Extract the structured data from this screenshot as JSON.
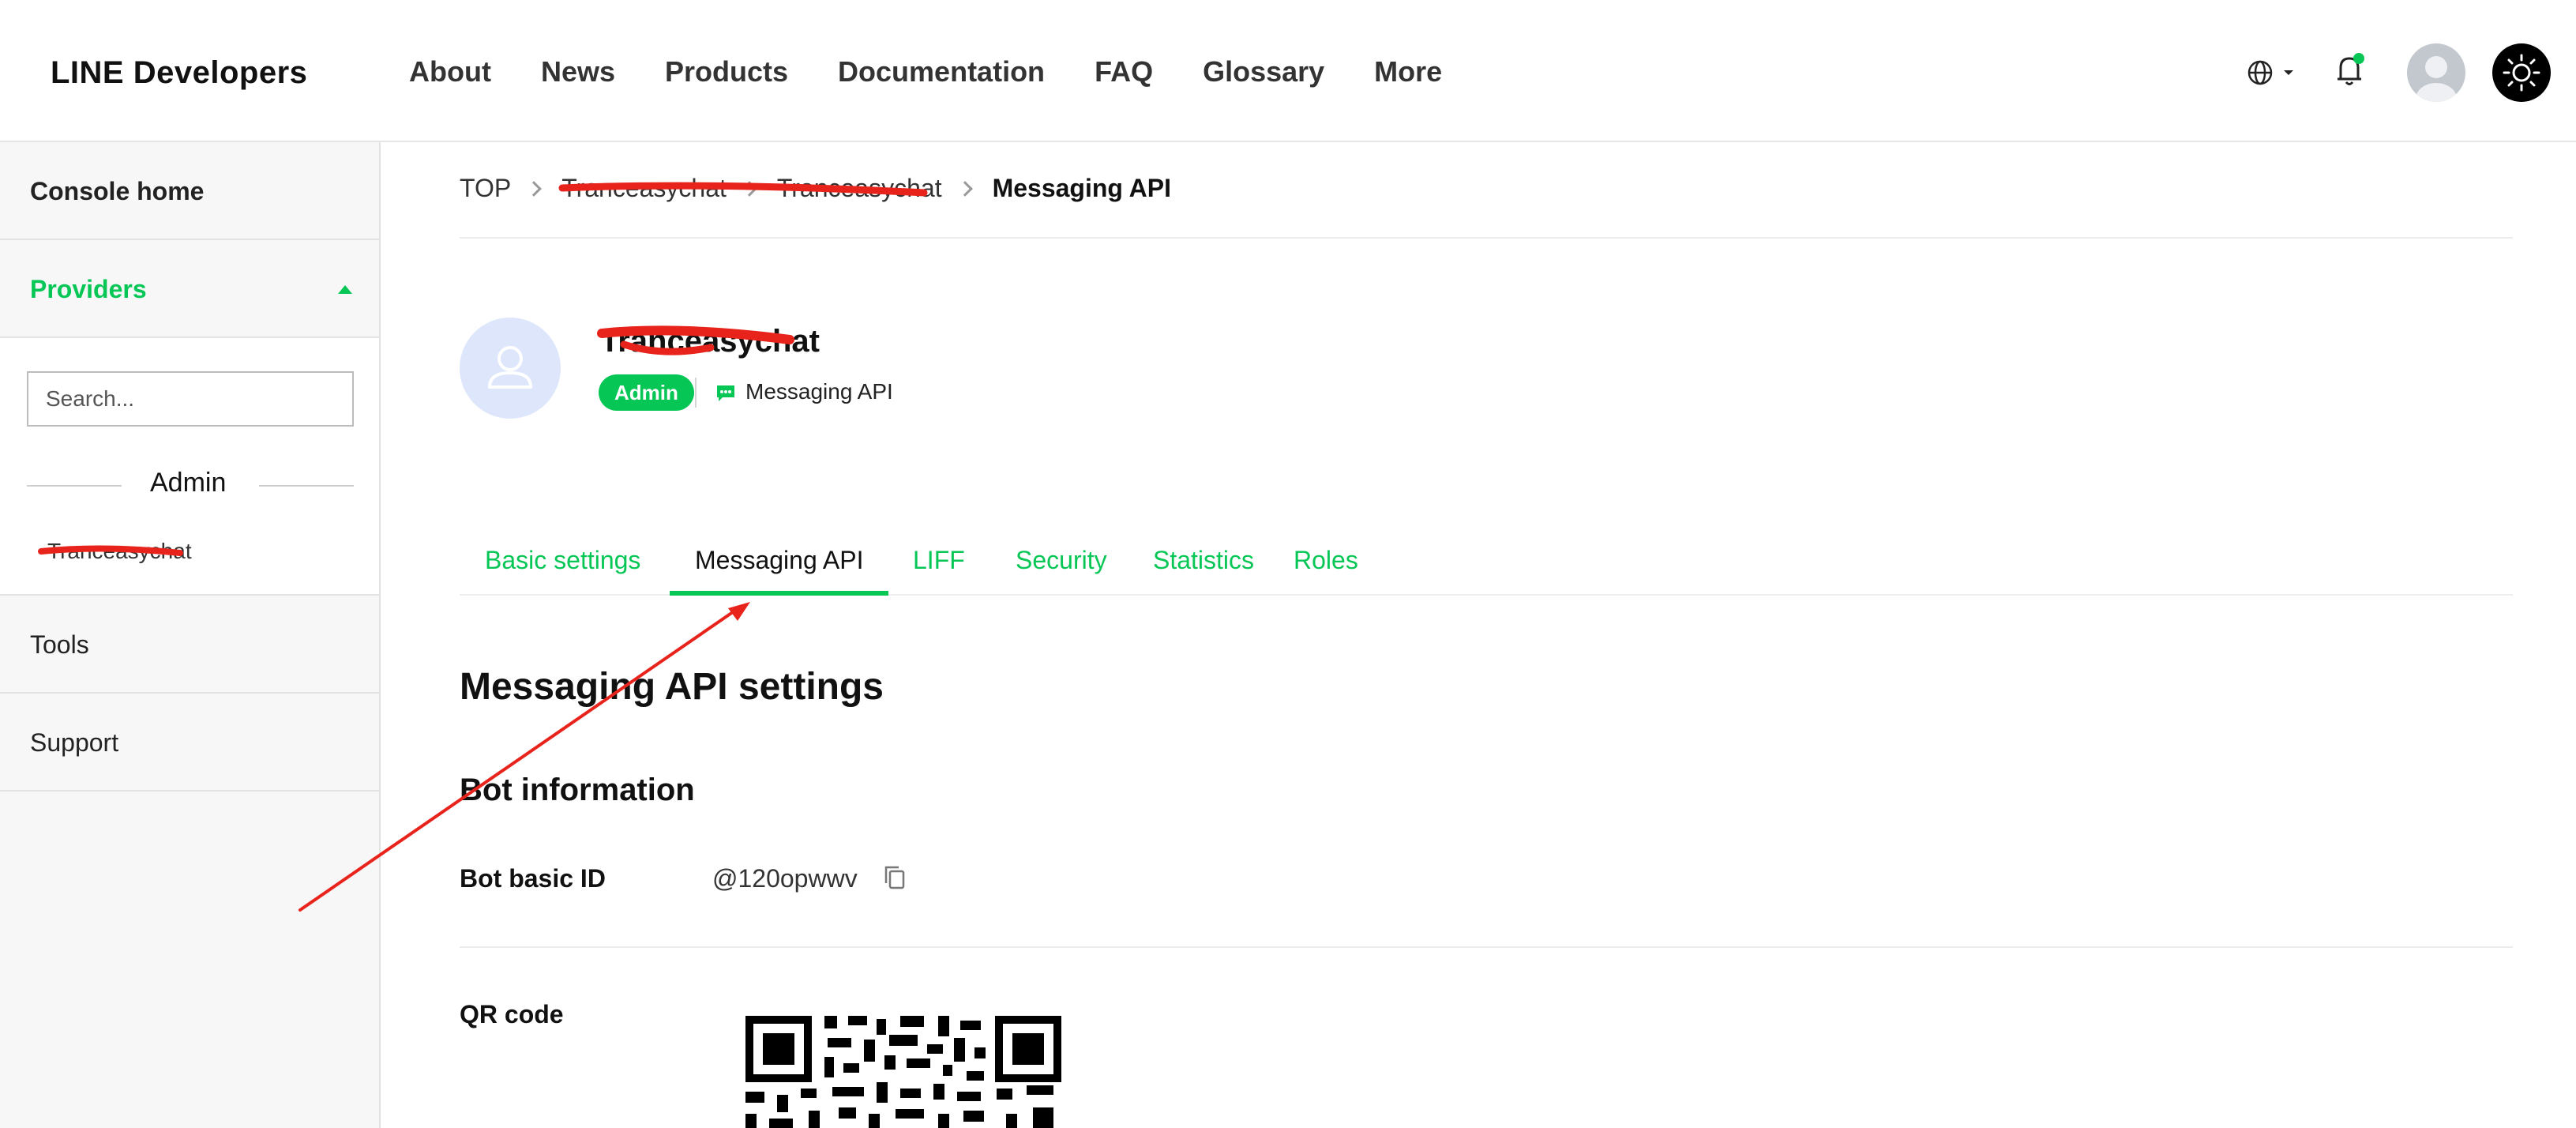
{
  "header": {
    "logo": "LINE Developers",
    "nav": [
      "About",
      "News",
      "Products",
      "Documentation",
      "FAQ",
      "Glossary",
      "More"
    ],
    "icons": [
      "globe-icon",
      "bell-icon",
      "avatar",
      "sun-icon"
    ],
    "notification_dot_color": "#06c755"
  },
  "sidebar": {
    "console_home": "Console home",
    "providers": "Providers",
    "search_placeholder": "Search...",
    "group_label": "Admin",
    "provider_item": "Tranceasychat",
    "tools": "Tools",
    "support": "Support"
  },
  "breadcrumb": {
    "items": [
      "TOP",
      "Tranceasychat",
      "Tranceasychat",
      "Messaging API"
    ]
  },
  "channel": {
    "name": "Tranceasychat",
    "role_badge": "Admin",
    "type": "Messaging API"
  },
  "tabs": {
    "items": [
      "Basic settings",
      "Messaging API",
      "LIFF",
      "Security",
      "Statistics",
      "Roles"
    ],
    "active": "Messaging API"
  },
  "content": {
    "title": "Messaging API settings",
    "section": "Bot information",
    "bot_id_label": "Bot basic ID",
    "bot_id_value": "@120opwwv",
    "qr_label": "QR code"
  },
  "colors": {
    "accent": "#06c755",
    "annotation": "#e8231b"
  }
}
